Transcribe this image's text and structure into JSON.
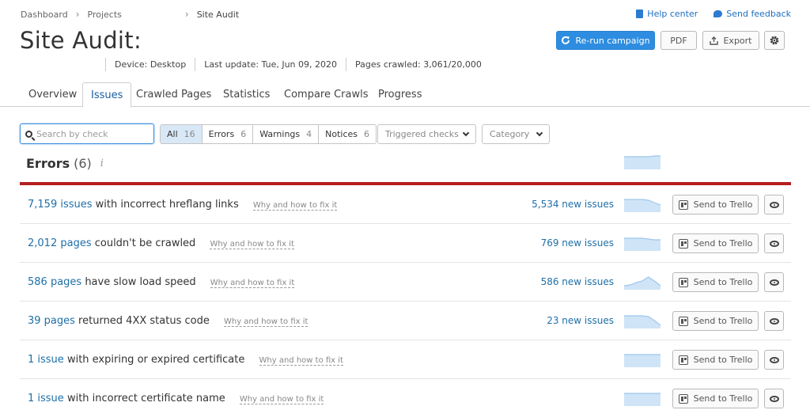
{
  "breadcrumb": {
    "items": [
      "Dashboard",
      "Projects",
      "Site Audit"
    ]
  },
  "top_links": {
    "help": "Help center",
    "feedback": "Send feedback"
  },
  "page_title": "Site Audit:",
  "actions": {
    "rerun": "Re-run campaign",
    "pdf": "PDF",
    "export": "Export"
  },
  "meta": {
    "device": "Device: Desktop",
    "last_update": "Last update: Tue, Jun 09, 2020",
    "pages_crawled": "Pages crawled: 3,061/20,000"
  },
  "tabs": [
    {
      "label": "Overview"
    },
    {
      "label": "Issues",
      "active": true
    },
    {
      "label": "Crawled Pages"
    },
    {
      "label": "Statistics"
    },
    {
      "label": "Compare Crawls"
    },
    {
      "label": "Progress"
    }
  ],
  "search": {
    "placeholder": "Search by check",
    "value": ""
  },
  "filters": [
    {
      "label": "All",
      "count": "16",
      "active": true
    },
    {
      "label": "Errors",
      "count": "6"
    },
    {
      "label": "Warnings",
      "count": "4"
    },
    {
      "label": "Notices",
      "count": "6"
    }
  ],
  "dropdowns": {
    "triggered": "Triggered checks",
    "category": "Category"
  },
  "errors_section": {
    "title": "Errors",
    "count": "(6)",
    "info": "i"
  },
  "issues": [
    {
      "link": "7,159 issues",
      "text": " with incorrect hreflang links",
      "why": "Why and how to fix it",
      "new_issues": "5,534 new issues",
      "trello": "Send to Trello",
      "spark": [
        0.8,
        0.8,
        0.8,
        0.8,
        0.75,
        0.6,
        0.45
      ]
    },
    {
      "link": "2,012 pages",
      "text": " couldn't be crawled",
      "why": "Why and how to fix it",
      "new_issues": "769 new issues",
      "trello": "Send to Trello",
      "spark": [
        0.8,
        0.8,
        0.8,
        0.8,
        0.75,
        0.7,
        0.7
      ]
    },
    {
      "link": "586 pages",
      "text": " have slow load speed",
      "why": "Why and how to fix it",
      "new_issues": "586 new issues",
      "trello": "Send to Trello",
      "spark": [
        0.25,
        0.3,
        0.45,
        0.55,
        0.8,
        0.55,
        0.25
      ]
    },
    {
      "link": "39 pages",
      "text": " returned 4XX status code",
      "why": "Why and how to fix it",
      "new_issues": "23 new issues",
      "trello": "Send to Trello",
      "spark": [
        0.8,
        0.8,
        0.8,
        0.8,
        0.75,
        0.5,
        0.2
      ]
    },
    {
      "link": "1 issue",
      "text": " with expiring or expired certificate",
      "why": "Why and how to fix it",
      "new_issues": "",
      "trello": "Send to Trello",
      "spark": [
        0.8,
        0.8,
        0.8,
        0.8,
        0.8,
        0.8,
        0.8
      ]
    },
    {
      "link": "1 issue",
      "text": " with incorrect certificate name",
      "why": "Why and how to fix it",
      "new_issues": "",
      "trello": "Send to Trello",
      "spark": [
        0.8,
        0.8,
        0.8,
        0.8,
        0.8,
        0.8,
        0.8
      ]
    }
  ],
  "header_spark": [
    0.8,
    0.8,
    0.8,
    0.8,
    0.8,
    0.85,
    0.85
  ],
  "colors": {
    "accent": "#2e8de0",
    "error_bar": "#b51f1f",
    "link": "#1e6fa8",
    "spark_fill": "#cfe4f7",
    "spark_line": "#9ec7ec"
  }
}
